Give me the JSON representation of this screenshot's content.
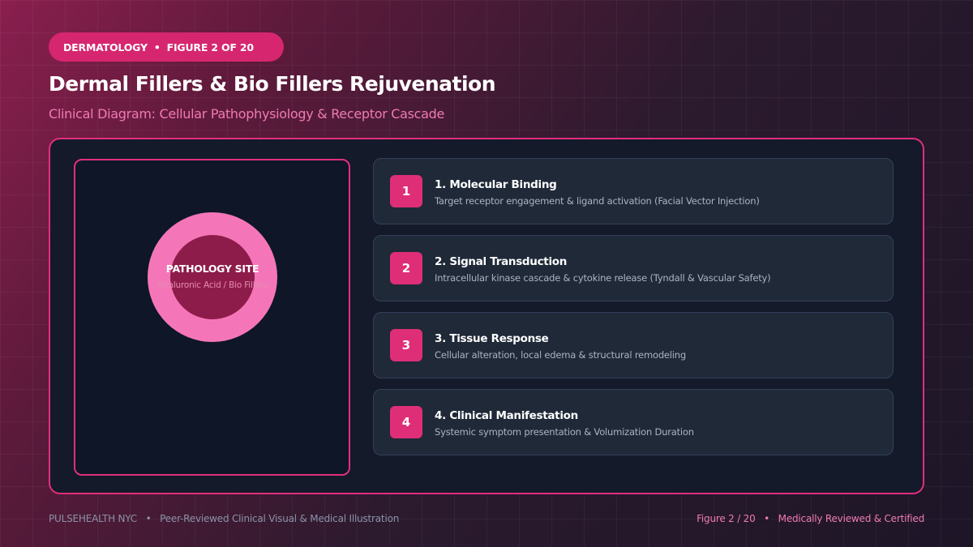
{
  "header": {
    "category": "DERMATOLOGY",
    "separator": "•",
    "figure_badge": "FIGURE 2 OF 20",
    "title": "Dermal Fillers & Bio Fillers Rejuvenation",
    "subtitle": "Clinical Diagram: Cellular Pathophysiology & Receptor Cascade"
  },
  "diagram": {
    "site_label": "PATHOLOGY SITE",
    "site_sublabel": "Hyaluronic Acid / Bio Fillers"
  },
  "steps": [
    {
      "number": "1",
      "title": "1. Molecular Binding",
      "description": "Target receptor engagement & ligand activation (Facial Vector Injection)"
    },
    {
      "number": "2",
      "title": "2. Signal Transduction",
      "description": "Intracellular kinase cascade & cytokine release (Tyndall & Vascular Safety)"
    },
    {
      "number": "3",
      "title": "3. Tissue Response",
      "description": "Cellular alteration, local edema & structural remodeling"
    },
    {
      "number": "4",
      "title": "4. Clinical Manifestation",
      "description": "Systemic symptom presentation & Volumization Duration"
    }
  ],
  "footer": {
    "brand": "PULSEHEALTH NYC",
    "separator": "•",
    "tagline": "Peer-Reviewed Clinical Visual & Medical Illustration",
    "figure_page": "Figure 2 / 20",
    "certification": "Medically Reviewed & Certified"
  },
  "colors": {
    "accent": "#e22e7e",
    "ring": "#f576b8",
    "core": "#8e1c4a",
    "panel": "#141a29",
    "card": "#1f2938"
  }
}
